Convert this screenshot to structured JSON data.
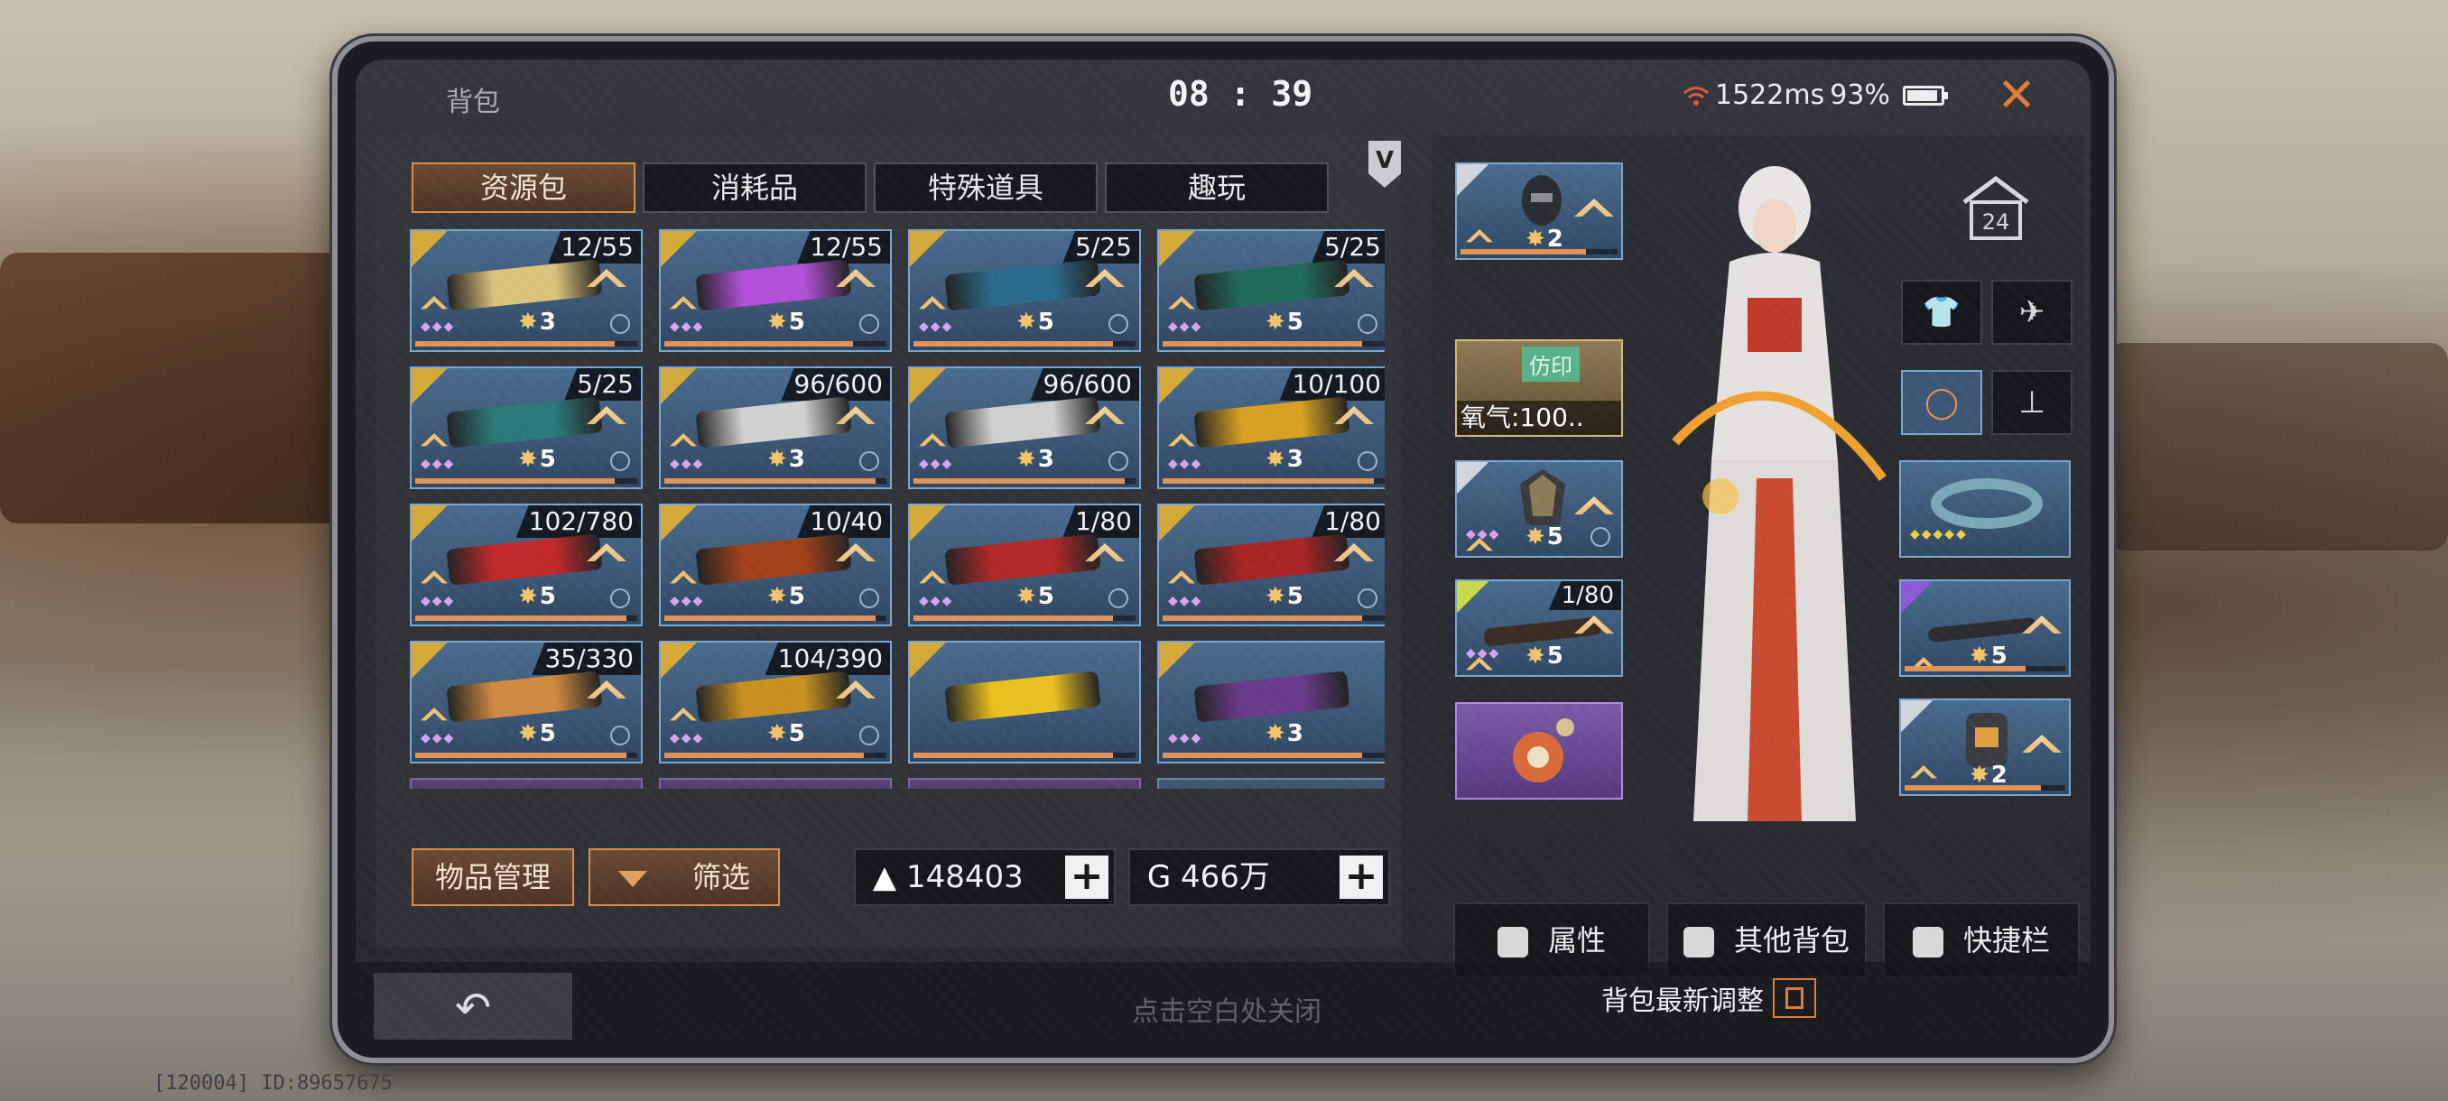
{
  "window": {
    "title": "背包",
    "clock": "08 : 39",
    "ping": "1522ms",
    "battery": "93%"
  },
  "tabs": [
    {
      "label": "资源包",
      "active": true
    },
    {
      "label": "消耗品",
      "active": false
    },
    {
      "label": "特殊道具",
      "active": false
    },
    {
      "label": "趣玩",
      "active": false
    }
  ],
  "items": [
    {
      "count": "12/55",
      "level": "3",
      "color": "#d9c27a",
      "fill": 0.9
    },
    {
      "count": "12/55",
      "level": "5",
      "color": "#b24fd8",
      "fill": 0.85
    },
    {
      "count": "5/25",
      "level": "5",
      "color": "#2a6a8a",
      "fill": 0.9
    },
    {
      "count": "5/25",
      "level": "5",
      "color": "#1f6a5a",
      "fill": 0.9
    },
    {
      "count": "5/25",
      "level": "5",
      "color": "#2a7a7a",
      "fill": 0.9
    },
    {
      "count": "96/600",
      "level": "3",
      "color": "#d0d0d0",
      "fill": 0.95
    },
    {
      "count": "96/600",
      "level": "3",
      "color": "#cfcfcf",
      "fill": 0.95
    },
    {
      "count": "10/100",
      "level": "3",
      "color": "#d6a020",
      "fill": 0.95
    },
    {
      "count": "102/780",
      "level": "5",
      "color": "#c0282a",
      "fill": 0.95
    },
    {
      "count": "10/40",
      "level": "5",
      "color": "#a0401a",
      "fill": 0.95
    },
    {
      "count": "1/80",
      "level": "5",
      "color": "#b02828",
      "fill": 0.9
    },
    {
      "count": "1/80",
      "level": "5",
      "color": "#a82424",
      "fill": 0.9
    },
    {
      "count": "35/330",
      "level": "5",
      "color": "#d08a40",
      "fill": 0.95
    },
    {
      "count": "104/390",
      "level": "5",
      "color": "#c89020",
      "fill": 0.9
    },
    {
      "count": "",
      "level": "",
      "color": "#e8c020",
      "fill": 0.9
    },
    {
      "count": "",
      "level": "3",
      "color": "#6a3a8a",
      "fill": 0.9
    }
  ],
  "actions": {
    "manage": "物品管理",
    "filter": "筛选"
  },
  "currency": [
    {
      "icon": "▲",
      "value": "148403"
    },
    {
      "icon": "G",
      "value": "466万"
    }
  ],
  "equip": {
    "oxygen_tag": "仿印",
    "oxygen_label": "氧气:100..",
    "slot_levels": {
      "helmet": "2",
      "armor": "5",
      "weapon": "5",
      "ring": "",
      "secondary": "5",
      "backpack": "2"
    },
    "weapon_count": "1/80",
    "house_level": "24"
  },
  "buttons": [
    {
      "label": "属性"
    },
    {
      "label": "其他背包"
    },
    {
      "label": "快捷栏"
    }
  ],
  "footer": {
    "back": "↶",
    "hint": "点击空白处关闭",
    "news": "背包最新调整"
  },
  "id_line": "[120004] ID:89657675"
}
